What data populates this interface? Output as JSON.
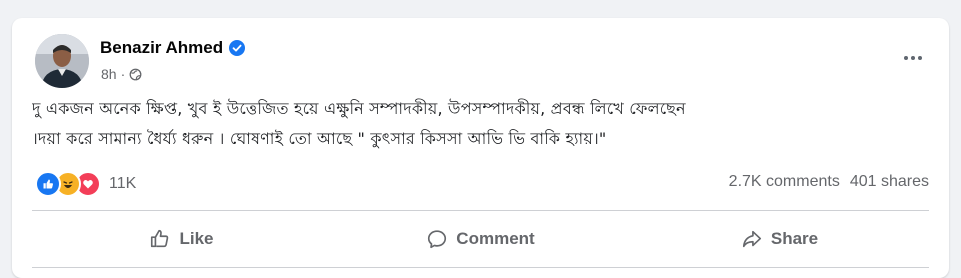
{
  "post": {
    "author": "Benazir Ahmed",
    "time": "8h",
    "dot": "·",
    "text_lines": [
      "দু একজন অনেক ক্ষিপ্ত, খুব ই উত্তেজিত হয়ে এক্ষুনি সম্পাদকীয়, উপসম্পাদকীয়, প্রবন্ধ লিখে ফেলছেন",
      "।দয়া করে সামান্য ধৈর্য্য ধরুন । ঘোষণাই তো আছে    \" কুৎসার কিসসা আভি ভি বাকি হ্যায়।\""
    ]
  },
  "reactions": {
    "count": "11K",
    "types": [
      "like",
      "haha",
      "love"
    ]
  },
  "stats": {
    "comments": "2.7K comments",
    "shares": "401 shares"
  },
  "actions": {
    "like": "Like",
    "comment": "Comment",
    "share": "Share"
  },
  "icons": {
    "verified": "verified-badge-icon",
    "audience": "globe-icon",
    "more": "more-options-icon",
    "like": "thumbs-up-icon",
    "comment": "speech-bubble-icon",
    "share": "share-arrow-icon"
  },
  "colors": {
    "brand": "#1877f2",
    "text_primary": "#050505",
    "text_secondary": "#65676b",
    "love": "#f33e58",
    "haha": "#f7b125"
  }
}
